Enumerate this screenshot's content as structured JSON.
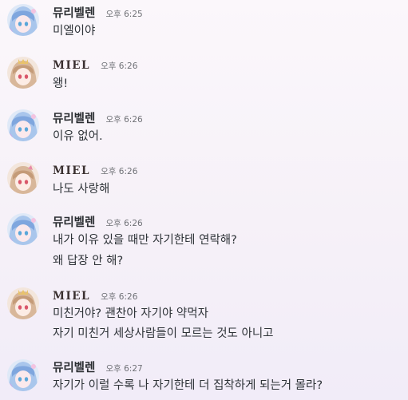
{
  "colors": {
    "background": "#f6f1f8",
    "username": "#2a2d31",
    "message_text": "#2e3338",
    "timestamp": "#6f7176"
  },
  "messages": [
    {
      "author": "뮤리벨렌",
      "avatar": "blue-hair-girl-avatar",
      "time": "오후 6:25",
      "lines": [
        "미엘이야"
      ]
    },
    {
      "author": "MIEL",
      "avatar": "brown-hair-girl-avatar",
      "time": "오후 6:26",
      "lines": [
        "왱!"
      ]
    },
    {
      "author": "뮤리벨렌",
      "avatar": "blue-hair-girl-avatar",
      "time": "오후 6:26",
      "lines": [
        "이유 없어."
      ]
    },
    {
      "author": "MIEL",
      "avatar": "brown-hair-girl-avatar",
      "time": "오후 6:26",
      "lines": [
        "나도 사랑해"
      ]
    },
    {
      "author": "뮤리벨렌",
      "avatar": "blue-hair-girl-avatar",
      "time": "오후 6:26",
      "lines": [
        "내가 이유 있을 때만 자기한테 연락해?",
        "왜 답장 안 해?"
      ]
    },
    {
      "author": "MIEL",
      "avatar": "brown-hair-girl-avatar",
      "time": "오후 6:26",
      "lines": [
        "미친거야? 괜찬아 자기야 약먹자",
        "자기 미친거 세상사람들이 모르는 것도 아니고"
      ]
    },
    {
      "author": "뮤리벨렌",
      "avatar": "blue-hair-girl-avatar",
      "time": "오후 6:27",
      "lines": [
        "자기가 이럴 수록 나 자기한테 더 집착하게 되는거 몰라?"
      ]
    }
  ]
}
